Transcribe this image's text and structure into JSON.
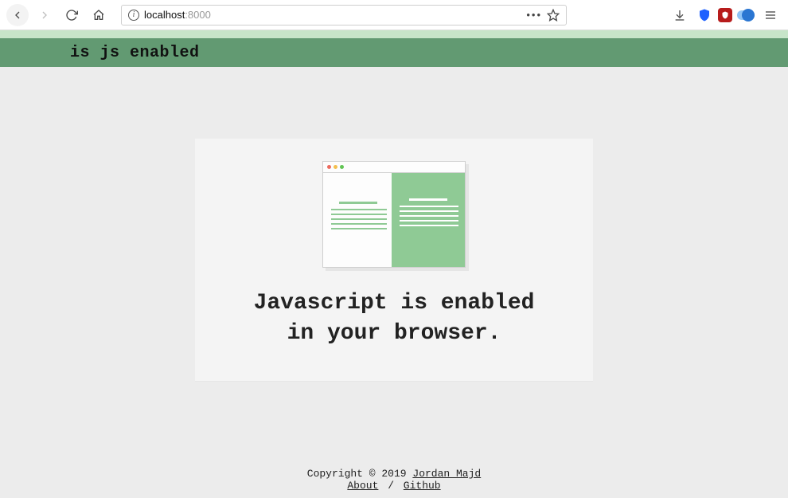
{
  "browser": {
    "url_host": "localhost",
    "url_port": ":8000",
    "more_dots": "•••"
  },
  "header": {
    "title": "is js enabled"
  },
  "main": {
    "message_line1": "Javascript is enabled",
    "message_line2": "in your browser."
  },
  "footer": {
    "copyright": "Copyright © 2019 ",
    "author": "Jordan Majd",
    "about": "About",
    "sep": " / ",
    "github": "Github"
  }
}
